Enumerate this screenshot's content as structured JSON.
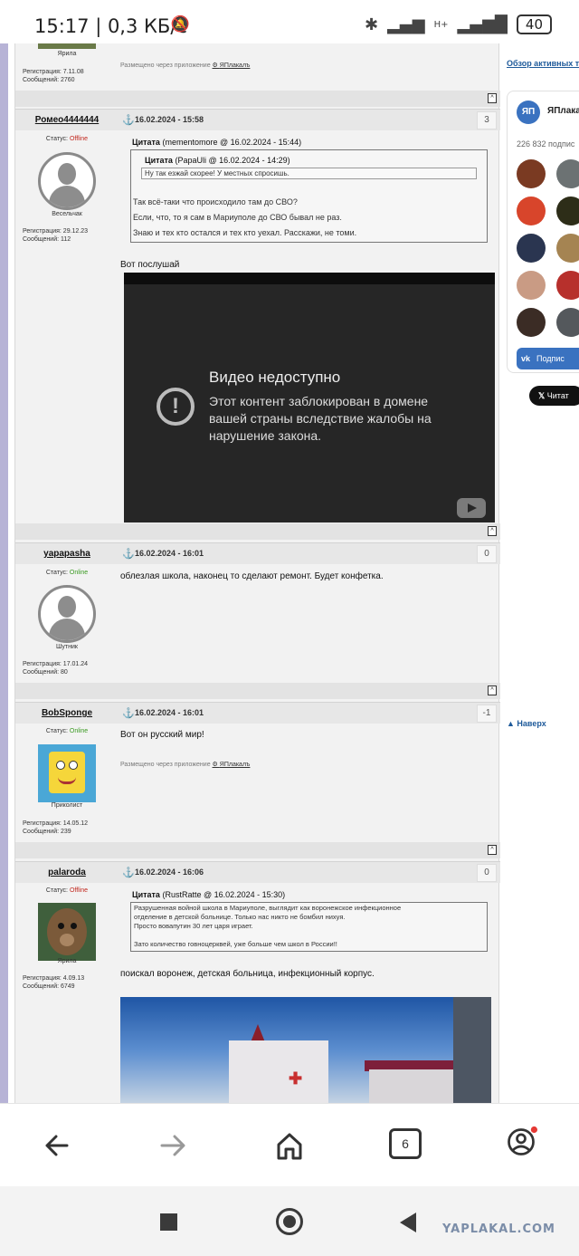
{
  "status_bar": {
    "time_speed": "15:17 | 0,3 КБ/с",
    "network": "H+",
    "battery": "40"
  },
  "posts": [
    {
      "rank": "Ярила",
      "registration": "Регистрация: 7.11.08",
      "messages": "Сообщений: 2760",
      "via_prefix": "Размещено через приложение",
      "via_app": "ЯПлакалъ"
    },
    {
      "author": "Ромео4444444",
      "date": "16.02.2024 - 15:58",
      "rating": "3",
      "status_label": "Статус:",
      "status": "Offline",
      "rank": "Весельчак",
      "registration": "Регистрация: 29.12.23",
      "messages": "Сообщений: 112",
      "quote_label": "Цитата",
      "quote_meta": "(mementomore @ 16.02.2024 - 15:44)",
      "inner_quote_meta": "(PapaUli @ 16.02.2024 - 14:29)",
      "inner_quote_text": "Ну так езжай скорее! У местных спросишь.",
      "quote_lines": [
        "Так всё-таки что происходило там до СВО?",
        "Если, что, то я сам в Мариуполе до СВО бывал не раз.",
        "Знаю и тех кто остался и тех кто уехал. Расскажи, не томи."
      ],
      "text": "Вот послушай",
      "video": {
        "title": "Видео недоступно",
        "message": "Этот контент заблокирован в домене вашей страны вследствие жалобы на нарушение закона."
      }
    },
    {
      "author": "yapapasha",
      "date": "16.02.2024 - 16:01",
      "rating": "0",
      "status_label": "Статус:",
      "status": "Online",
      "rank": "Шутник",
      "registration": "Регистрация: 17.01.24",
      "messages": "Сообщений: 80",
      "text": "облезлая школа, наконец то сделают ремонт. Будет конфетка."
    },
    {
      "author": "BobSponge",
      "date": "16.02.2024 - 16:01",
      "rating": "-1",
      "status_label": "Статус:",
      "status": "Online",
      "rank": "Приколист",
      "registration": "Регистрация: 14.05.12",
      "messages": "Сообщений: 239",
      "text": "Вот он русский мир!",
      "via_prefix": "Размещено через приложение",
      "via_app": "ЯПлакалъ"
    },
    {
      "author": "palaroda",
      "date": "16.02.2024 - 16:06",
      "rating": "0",
      "status_label": "Статус:",
      "status": "Offline",
      "rank": "Ярила",
      "registration": "Регистрация: 4.09.13",
      "messages": "Сообщений: 6749",
      "quote_label": "Цитата",
      "quote_meta": "(RustRatte @ 16.02.2024 - 15:30)",
      "quote_lines": [
        "Разрушенная войной школа в Мариуполе, выглядит как воронежское инфекционное",
        "отделение в детской больнице. Только нас никто не бомбил нихуя.",
        "Просто вовапутин 30 лет царя играет.",
        "",
        "Зато количество говноцерквей, уже больше чем школ в России!!"
      ],
      "text": "поискал воронеж, детская больница, инфекционный корпус."
    }
  ],
  "top_button": "^",
  "sidebar": {
    "active_topics_link": "Обзор активных т",
    "vk_group_name": "ЯПлака",
    "vk_logo": "ЯП",
    "vk_subscribers": "226 832 подпис",
    "vk_subscribe": "Подпис",
    "x_button": "Читат",
    "to_top": "▲ Наверх"
  },
  "browser_nav": {
    "tabs_count": "6"
  },
  "watermark": "YAPLAKAL.COM",
  "colors": {
    "offline": "#c2281e",
    "online": "#3a9a22",
    "link": "#1e5a9a",
    "vk_blue": "#3a72c0"
  }
}
